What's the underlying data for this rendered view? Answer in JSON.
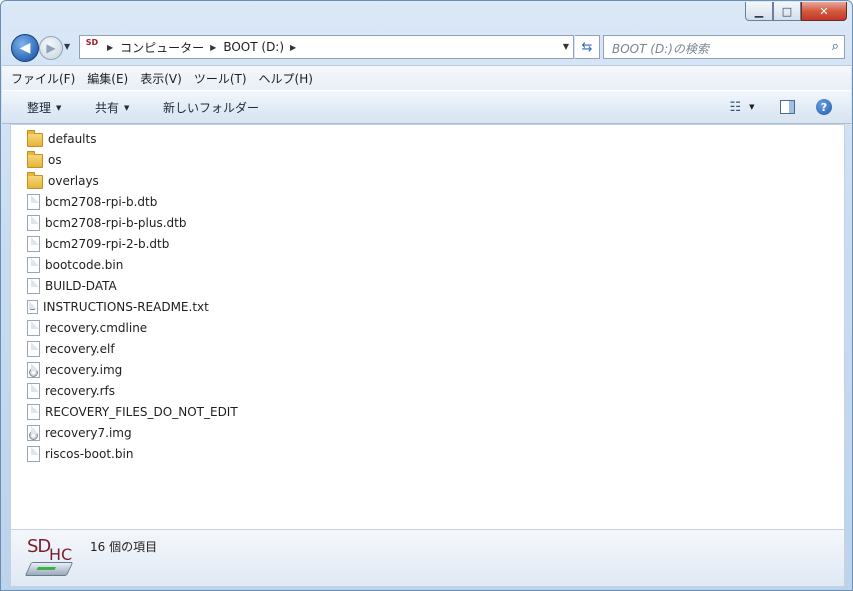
{
  "window": {
    "caption": {
      "minimize": "▁",
      "maximize": "□",
      "close": "✕"
    }
  },
  "nav": {
    "back_glyph": "◀",
    "forward_glyph": "▶",
    "drive_icon_text": "SD",
    "breadcrumbs": [
      "コンピューター",
      "BOOT (D:)"
    ],
    "search_placeholder": "BOOT (D:)の検索",
    "refresh_icon": "refresh-icon",
    "search_icon": "search-icon"
  },
  "menubar": {
    "items": [
      "ファイル(F)",
      "編集(E)",
      "表示(V)",
      "ツール(T)",
      "ヘルプ(H)"
    ]
  },
  "toolbar": {
    "organize": "整理",
    "share": "共有",
    "new_folder": "新しいフォルダー",
    "help": "?"
  },
  "files": [
    {
      "name": "defaults",
      "type": "folder"
    },
    {
      "name": "os",
      "type": "folder"
    },
    {
      "name": "overlays",
      "type": "folder"
    },
    {
      "name": "bcm2708-rpi-b.dtb",
      "type": "file"
    },
    {
      "name": "bcm2708-rpi-b-plus.dtb",
      "type": "file"
    },
    {
      "name": "bcm2709-rpi-2-b.dtb",
      "type": "file"
    },
    {
      "name": "bootcode.bin",
      "type": "file"
    },
    {
      "name": "BUILD-DATA",
      "type": "file"
    },
    {
      "name": "INSTRUCTIONS-README.txt",
      "type": "text"
    },
    {
      "name": "recovery.cmdline",
      "type": "file"
    },
    {
      "name": "recovery.elf",
      "type": "file"
    },
    {
      "name": "recovery.img",
      "type": "disc"
    },
    {
      "name": "recovery.rfs",
      "type": "file"
    },
    {
      "name": "RECOVERY_FILES_DO_NOT_EDIT",
      "type": "file"
    },
    {
      "name": "recovery7.img",
      "type": "disc"
    },
    {
      "name": "riscos-boot.bin",
      "type": "file"
    }
  ],
  "status": {
    "logo_sd": "SD",
    "logo_hc": "HC",
    "item_count": "16 個の項目"
  }
}
